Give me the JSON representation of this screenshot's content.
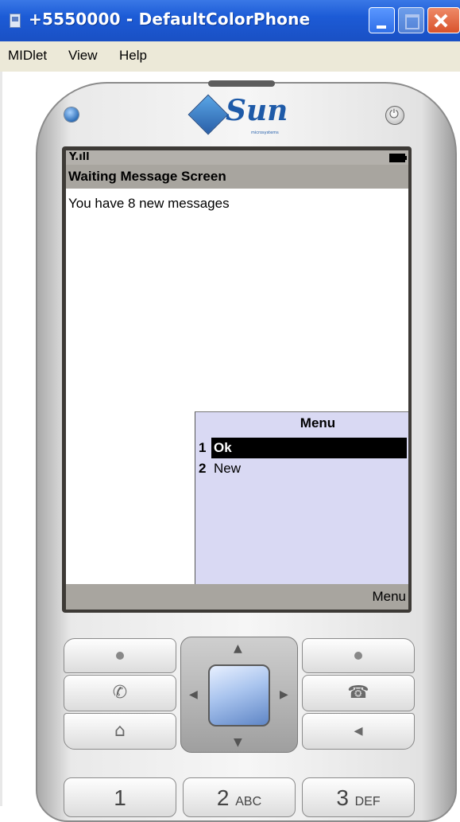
{
  "window": {
    "title": "+5550000 - DefaultColorPhone",
    "menu": [
      "MIDlet",
      "View",
      "Help"
    ]
  },
  "phone": {
    "brand": "Sun",
    "brand_sub": "microsystems",
    "status_signal": "Y.ıll",
    "screen_title": "Waiting Message Screen",
    "message": "You have 8 new messages",
    "menu": {
      "title": "Menu",
      "items": [
        {
          "num": "1",
          "label": "Ok",
          "selected": true
        },
        {
          "num": "2",
          "label": "New",
          "selected": false
        }
      ]
    },
    "softkey_right": "Menu"
  },
  "keypad": {
    "keys": [
      {
        "num": "1",
        "letters": ""
      },
      {
        "num": "2",
        "letters": "ABC"
      },
      {
        "num": "3",
        "letters": "DEF"
      }
    ]
  },
  "colors": {
    "titlebar": "#1c5bd6",
    "menu_bg": "#d9d9f3",
    "screen_bar": "#a8a59f",
    "selected_bg": "#000000"
  }
}
